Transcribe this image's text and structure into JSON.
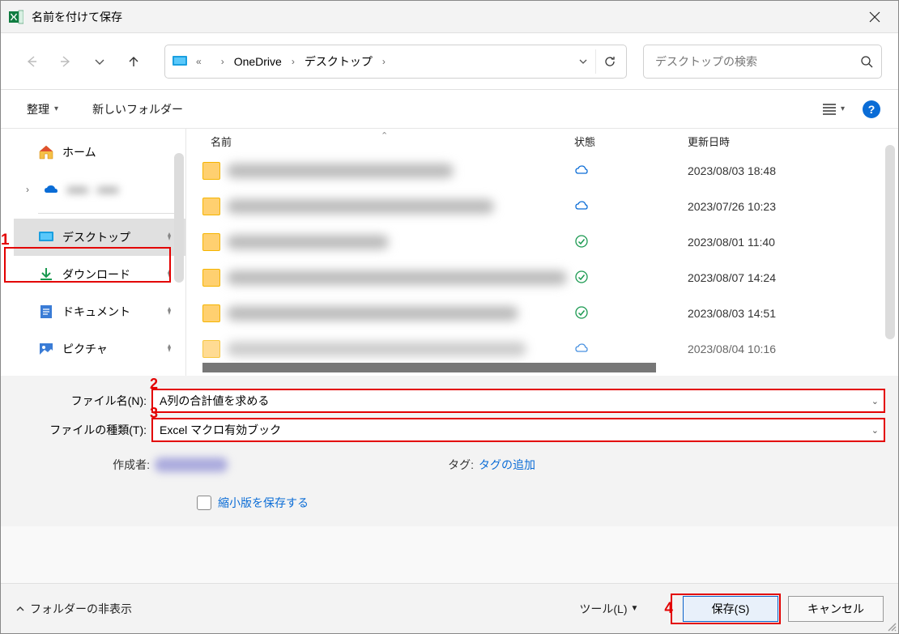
{
  "window": {
    "title": "名前を付けて保存"
  },
  "annotations": {
    "n1": "1",
    "n2": "2",
    "n3": "3",
    "n4": "4"
  },
  "nav": {
    "path_segments": [
      "",
      "OneDrive",
      "デスクトップ"
    ],
    "search_placeholder": "デスクトップの検索"
  },
  "toolbar": {
    "organize": "整理",
    "new_folder": "新しいフォルダー"
  },
  "sidebar": {
    "home": "ホーム",
    "onedrive_blur": "■■■ - ■■■",
    "desktop": "デスクトップ",
    "downloads": "ダウンロード",
    "documents": "ドキュメント",
    "pictures": "ピクチャ"
  },
  "filelist": {
    "col_name": "名前",
    "col_state": "状態",
    "col_date": "更新日時",
    "rows": [
      {
        "state": "cloud",
        "date": "2023/08/03 18:48"
      },
      {
        "state": "cloud",
        "date": "2023/07/26 10:23"
      },
      {
        "state": "check",
        "date": "2023/08/01 11:40"
      },
      {
        "state": "check",
        "date": "2023/08/07 14:24"
      },
      {
        "state": "check",
        "date": "2023/08/03 14:51"
      },
      {
        "state": "cloud",
        "date": "2023/08/04 10:16"
      }
    ]
  },
  "form": {
    "filename_label": "ファイル名(N):",
    "filename_value": "A列の合計値を求める",
    "filetype_label": "ファイルの種類(T):",
    "filetype_value": "Excel マクロ有効ブック",
    "author_label": "作成者:",
    "tags_label": "タグ:",
    "tags_value": "タグの追加",
    "save_thumbnail": "縮小版を保存する"
  },
  "footer": {
    "hide_folders": "フォルダーの非表示",
    "tools": "ツール(L)",
    "save": "保存(S)",
    "cancel": "キャンセル"
  }
}
